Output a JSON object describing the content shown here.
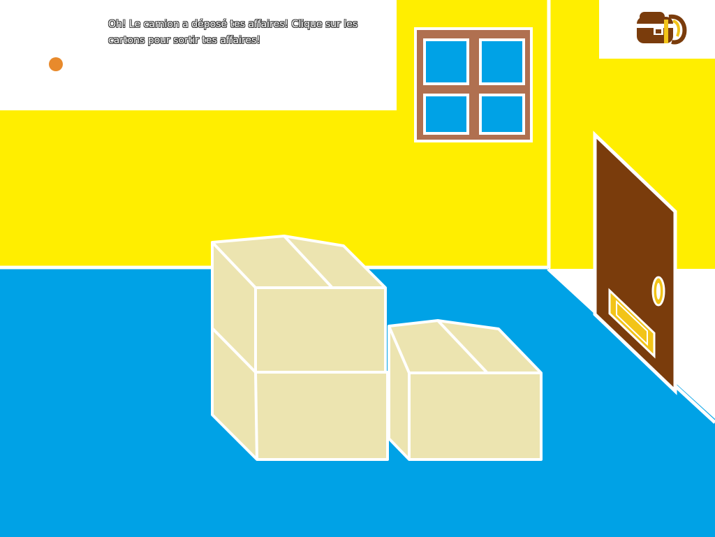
{
  "message": {
    "text": "Oh! Le camion a déposé tes affaires! Clique sur les cartons pour sortir tes affaires!"
  },
  "colors": {
    "wall": "#ffee00",
    "floor": "#00a2e6",
    "box_fill": "#ece4b0",
    "box_stroke": "#ffffff",
    "door": "#7a3c0c",
    "window_frame": "#b07050",
    "window_glass": "#00a2e6",
    "indicator_dot": "#e88a2c"
  },
  "icons": {
    "inventory": "backpack-icon"
  }
}
